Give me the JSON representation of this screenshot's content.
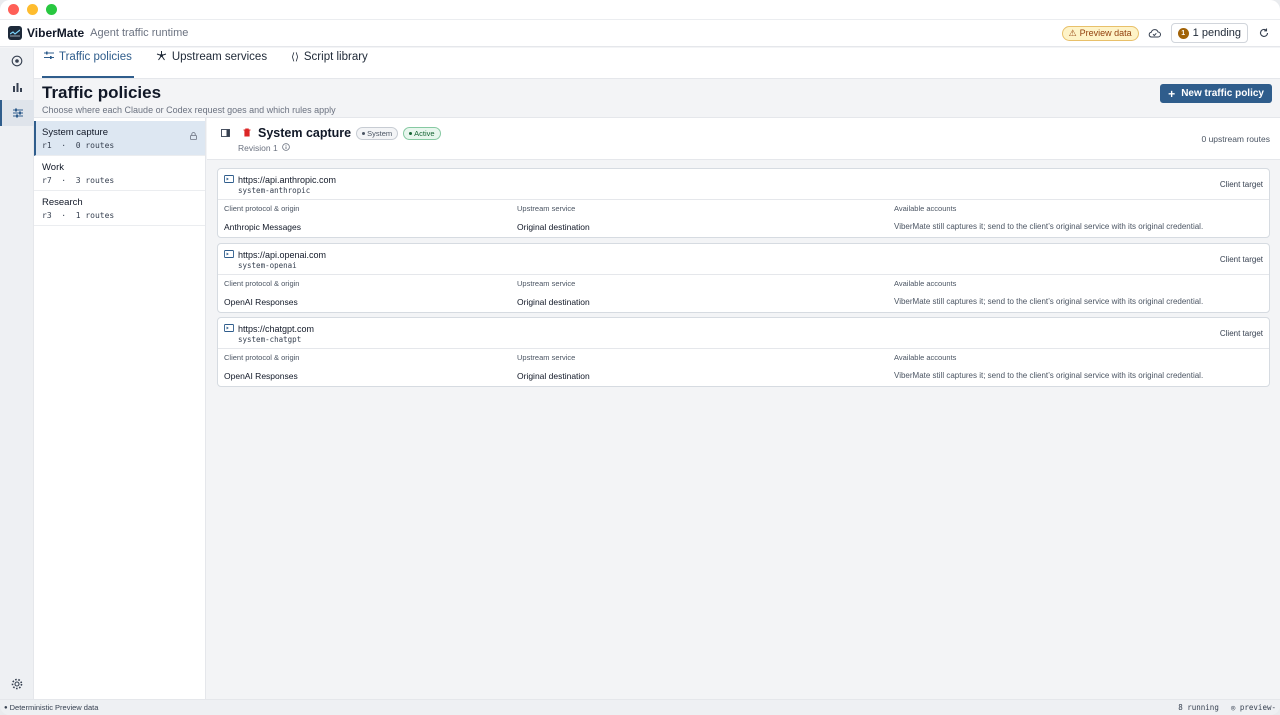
{
  "app": {
    "name": "ViberMate",
    "tagline": "Agent traffic runtime"
  },
  "header": {
    "preview_badge": "Preview data",
    "pending_count": "1",
    "pending_label": "1 pending"
  },
  "tabs": [
    {
      "label": "Traffic policies",
      "icon": "sliders-icon"
    },
    {
      "label": "Upstream services",
      "icon": "nodes-icon"
    },
    {
      "label": "Script library",
      "icon": "code-braces-icon"
    }
  ],
  "page": {
    "title": "Traffic policies",
    "subtitle": "Choose where each Claude or Codex request goes and which rules apply",
    "new_button": "New traffic policy"
  },
  "policies": [
    {
      "name": "System capture",
      "meta": "r1  ·  0 routes"
    },
    {
      "name": "Work",
      "meta": "r7  ·  3 routes"
    },
    {
      "name": "Research",
      "meta": "r3  ·  1 routes"
    }
  ],
  "detail": {
    "title": "System capture",
    "tag_system": "System",
    "tag_active": "Active",
    "revision": "Revision 1",
    "route_count": "0 upstream routes",
    "column_headers": {
      "protocol": "Client protocol & origin",
      "upstream": "Upstream service",
      "accounts": "Available accounts"
    },
    "target_label": "Client target",
    "cards": [
      {
        "url": "https://api.anthropic.com",
        "id": "system-anthropic",
        "protocol": "Anthropic Messages",
        "upstream": "Original destination",
        "accounts": "ViberMate still captures it; send to the client’s original service with its original credential."
      },
      {
        "url": "https://api.openai.com",
        "id": "system-openai",
        "protocol": "OpenAI Responses",
        "upstream": "Original destination",
        "accounts": "ViberMate still captures it; send to the client’s original service with its original credential."
      },
      {
        "url": "https://chatgpt.com",
        "id": "system-chatgpt",
        "protocol": "OpenAI Responses",
        "upstream": "Original destination",
        "accounts": "ViberMate still captures it; send to the client’s original service with its original credential."
      }
    ]
  },
  "statusbar": {
    "left": "Deterministic Preview data",
    "running": "8 running",
    "preview": "preview-"
  },
  "colors": {
    "accent": "#2f5d8c",
    "active_green": "#166534",
    "preview_amber": "#92400e"
  }
}
